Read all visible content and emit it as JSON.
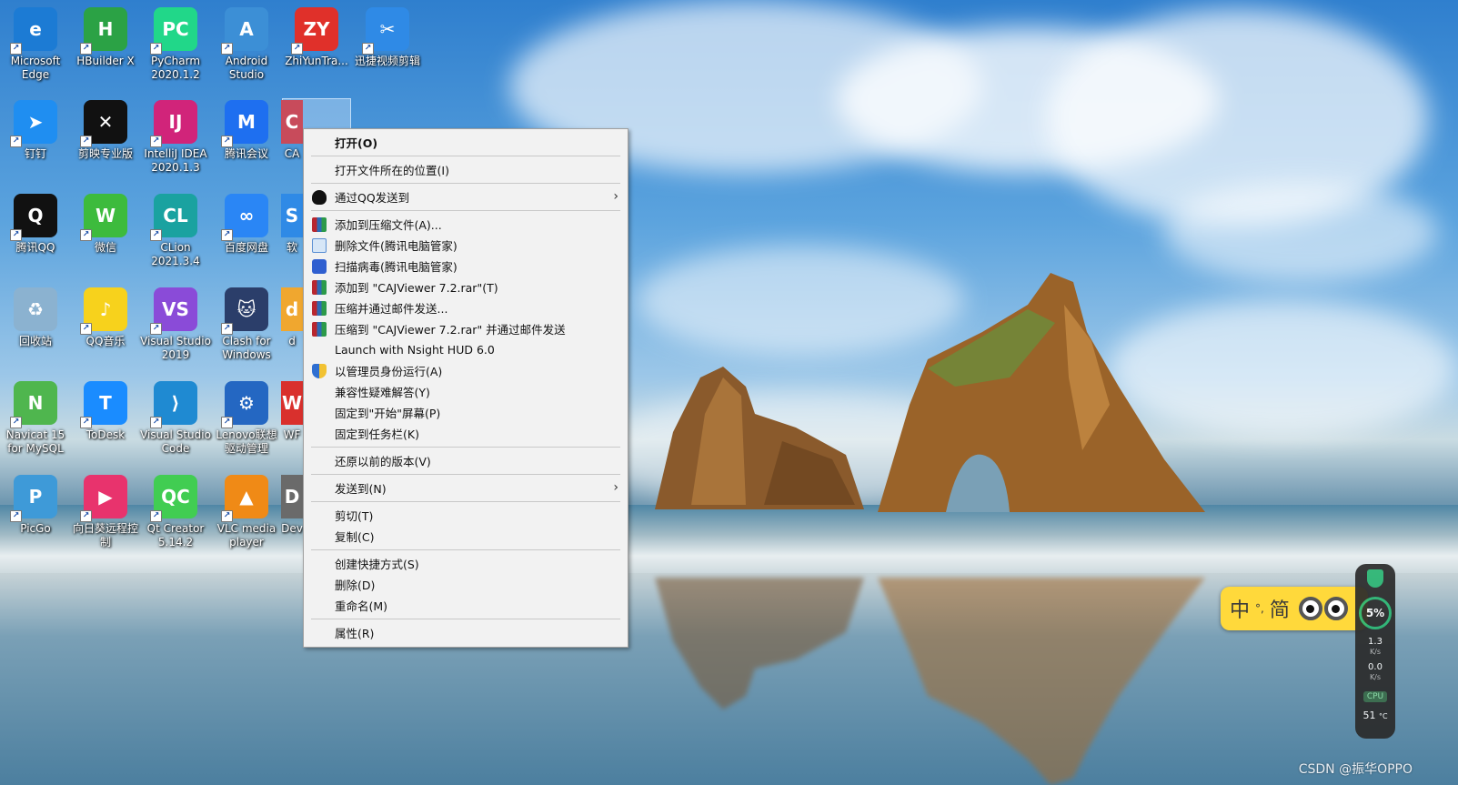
{
  "desktop_icons": [
    {
      "label": "Microsoft Edge",
      "icon": "edge-icon",
      "color": "#1c7bd4",
      "glyph": "e"
    },
    {
      "label": "HBuilder X",
      "icon": "hbuilder-icon",
      "color": "#2ba245",
      "glyph": "H"
    },
    {
      "label": "PyCharm 2020.1.2",
      "icon": "pycharm-icon",
      "color": "#21d789",
      "glyph": "PC"
    },
    {
      "label": "Android Studio",
      "icon": "android-studio-icon",
      "color": "#3c8fd6",
      "glyph": "A"
    },
    {
      "label": "ZhiYunTra...",
      "icon": "zhiyun-icon",
      "color": "#e0302a",
      "glyph": "ZY"
    },
    {
      "label": "迅捷视频剪辑",
      "icon": "video-editor-icon",
      "color": "#2f8ae6",
      "glyph": "✂"
    },
    {
      "label": "钉钉",
      "icon": "dingtalk-icon",
      "color": "#1f8ef1",
      "glyph": "➤"
    },
    {
      "label": "剪映专业版",
      "icon": "jianying-icon",
      "color": "#111111",
      "glyph": "✕"
    },
    {
      "label": "IntelliJ IDEA 2020.1.3",
      "icon": "intellij-icon",
      "color": "#d1247a",
      "glyph": "IJ"
    },
    {
      "label": "腾讯会议",
      "icon": "tencent-meeting-icon",
      "color": "#1e6ff0",
      "glyph": "M"
    },
    {
      "label": "CA",
      "icon": "cajviewer-icon",
      "color": "#c84b5b",
      "glyph": "C"
    },
    {
      "label": "腾讯QQ",
      "icon": "qq-icon",
      "color": "#111111",
      "glyph": "Q"
    },
    {
      "label": "微信",
      "icon": "wechat-icon",
      "color": "#3dbb3d",
      "glyph": "W"
    },
    {
      "label": "CLion 2021.3.4",
      "icon": "clion-icon",
      "color": "#1aa2a0",
      "glyph": "CL"
    },
    {
      "label": "百度网盘",
      "icon": "baidu-netdisk-icon",
      "color": "#2a86f5",
      "glyph": "∞"
    },
    {
      "label": "软",
      "icon": "software-icon",
      "color": "#2f8ae6",
      "glyph": "S"
    },
    {
      "label": "回收站",
      "icon": "recycle-bin-icon",
      "color": "#8bb2d0",
      "glyph": "♻"
    },
    {
      "label": "QQ音乐",
      "icon": "qq-music-icon",
      "color": "#f7d21c",
      "glyph": "♪"
    },
    {
      "label": "Visual Studio 2019",
      "icon": "visual-studio-icon",
      "color": "#8a4bd8",
      "glyph": "VS"
    },
    {
      "label": "Clash for Windows",
      "icon": "clash-icon",
      "color": "#2b3e6a",
      "glyph": "🐱"
    },
    {
      "label": "d",
      "icon": "folder-icon",
      "color": "#f0a72f",
      "glyph": "d"
    },
    {
      "label": "Navicat 15 for MySQL",
      "icon": "navicat-icon",
      "color": "#4fb64e",
      "glyph": "N"
    },
    {
      "label": "ToDesk",
      "icon": "todesk-icon",
      "color": "#1a8cff",
      "glyph": "T"
    },
    {
      "label": "Visual Studio Code",
      "icon": "vscode-icon",
      "color": "#1f8ad2",
      "glyph": "⟩"
    },
    {
      "label": "Lenovo联想驱动管理",
      "icon": "lenovo-driver-icon",
      "color": "#2467c2",
      "glyph": "⚙"
    },
    {
      "label": "WF",
      "icon": "wps-icon",
      "color": "#d9302d",
      "glyph": "W"
    },
    {
      "label": "PicGo",
      "icon": "picgo-icon",
      "color": "#3e9ad8",
      "glyph": "P"
    },
    {
      "label": "向日葵远程控制",
      "icon": "sunlogin-icon",
      "color": "#e8336d",
      "glyph": "▶"
    },
    {
      "label": "Qt Creator 5.14.2",
      "icon": "qt-creator-icon",
      "color": "#41cd52",
      "glyph": "QC"
    },
    {
      "label": "VLC media player",
      "icon": "vlc-icon",
      "color": "#f08a16",
      "glyph": "▲"
    },
    {
      "label": "Dev",
      "icon": "dev-cpp-icon",
      "color": "#6a6a6a",
      "glyph": "D"
    }
  ],
  "context_menu": {
    "open": "打开(O)",
    "open_location": "打开文件所在的位置(I)",
    "send_via_qq": "通过QQ发送到",
    "add_to_archive": "添加到压缩文件(A)...",
    "delete_file_tencent": "删除文件(腾讯电脑管家)",
    "scan_virus_tencent": "扫描病毒(腾讯电脑管家)",
    "add_to_rar": "添加到 \"CAJViewer 7.2.rar\"(T)",
    "compress_email": "压缩并通过邮件发送...",
    "compress_rar_email": "压缩到 \"CAJViewer 7.2.rar\" 并通过邮件发送",
    "nsight": "Launch with Nsight HUD 6.0",
    "run_as_admin": "以管理员身份运行(A)",
    "troubleshoot": "兼容性疑难解答(Y)",
    "pin_start": "固定到\"开始\"屏幕(P)",
    "pin_taskbar": "固定到任务栏(K)",
    "restore_versions": "还原以前的版本(V)",
    "send_to": "发送到(N)",
    "cut": "剪切(T)",
    "copy": "复制(C)",
    "create_shortcut": "创建快捷方式(S)",
    "delete": "删除(D)",
    "rename": "重命名(M)",
    "properties": "属性(R)"
  },
  "ime": {
    "lang": "中",
    "punct": "°,",
    "mode": "简"
  },
  "monitor": {
    "percent": "5%",
    "up_speed": "1.3",
    "up_unit": "K/s",
    "down_speed": "0.0",
    "down_unit": "K/s",
    "cpu_label": "CPU",
    "temp": "51",
    "temp_unit": "°C"
  },
  "watermark": "CSDN @振华OPPO"
}
